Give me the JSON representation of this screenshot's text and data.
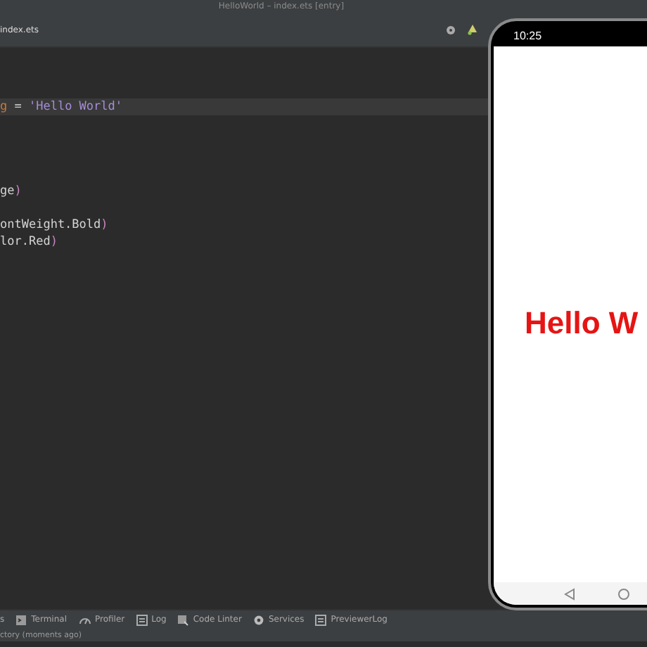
{
  "window": {
    "title": "HelloWorld – index.ets [entry]"
  },
  "tabs": [
    {
      "label": "index.ets",
      "selected": true
    }
  ],
  "editor": {
    "lines": [
      {
        "current": true,
        "tokens": [
          {
            "text": "g",
            "kind": "variable"
          },
          {
            "text": " = ",
            "kind": "plain"
          },
          {
            "text": "'Hello World'",
            "kind": "string"
          }
        ]
      },
      {
        "current": false,
        "tokens": [
          {
            "text": "ge",
            "kind": "plain"
          },
          {
            "text": ")",
            "kind": "paren"
          }
        ]
      },
      {
        "current": false,
        "tokens": [
          {
            "text": "ontWeight.Bold",
            "kind": "plain"
          },
          {
            "text": ")",
            "kind": "paren"
          }
        ]
      },
      {
        "current": false,
        "tokens": [
          {
            "text": "lor.Red",
            "kind": "plain"
          },
          {
            "text": ")",
            "kind": "paren"
          }
        ]
      }
    ]
  },
  "tool_windows": [
    {
      "label": "s",
      "kind": "plain"
    },
    {
      "label": "Terminal",
      "kind": "terminal"
    },
    {
      "label": "Profiler",
      "kind": "profiler"
    },
    {
      "label": "Log",
      "kind": "log"
    },
    {
      "label": "Code Linter",
      "kind": "linter"
    },
    {
      "label": "Services",
      "kind": "services"
    },
    {
      "label": "PreviewerLog",
      "kind": "log"
    }
  ],
  "status_bar": {
    "text": "ctory (moments ago)"
  },
  "previewer": {
    "time": "10:25",
    "text": "Hello W"
  }
}
